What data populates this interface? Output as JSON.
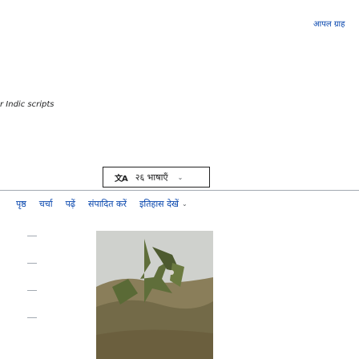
{
  "header": {
    "top_link": "आपल ग्राह"
  },
  "hint": {
    "text": "r Indic scripts"
  },
  "language_button": {
    "icon_text": "文A",
    "label": "२६ भाषाएँ",
    "chevron": "⌄"
  },
  "tabs": {
    "items": [
      "पृष्ठ",
      "चर्चा",
      "पढ़ें",
      "संपादित करें",
      "इतिहास देखें"
    ],
    "chevron": "⌄"
  },
  "photo": {
    "colors": {
      "sky": "#cfd1cd",
      "ground": "#8a7e5a",
      "plants": "#5f6e3a"
    }
  }
}
